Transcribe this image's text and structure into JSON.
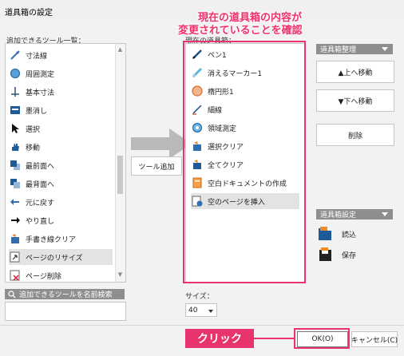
{
  "window": {
    "title": "道具箱の設定"
  },
  "annotation": {
    "line1": "現在の道具箱の内容が",
    "line2": "変更されていることを確認",
    "click": "クリック"
  },
  "available": {
    "label": "追加できるツール一覧：",
    "items": [
      {
        "label": "寸法線",
        "icon": "dimension-icon"
      },
      {
        "label": "周囲測定",
        "icon": "perimeter-icon"
      },
      {
        "label": "基本寸法",
        "icon": "basic-dimension-icon"
      },
      {
        "label": "墨消し",
        "icon": "redact-icon"
      },
      {
        "label": "選択",
        "icon": "cursor-icon"
      },
      {
        "label": "移動",
        "icon": "hand-icon"
      },
      {
        "label": "最前面へ",
        "icon": "bring-front-icon"
      },
      {
        "label": "最背面へ",
        "icon": "send-back-icon"
      },
      {
        "label": "元に戻す",
        "icon": "undo-icon"
      },
      {
        "label": "やり直し",
        "icon": "redo-icon"
      },
      {
        "label": "手書き線クリア",
        "icon": "clear-handwriting-icon"
      },
      {
        "label": "ページのリサイズ",
        "icon": "page-resize-icon"
      },
      {
        "label": "ページ削除",
        "icon": "page-delete-icon"
      }
    ]
  },
  "add_button": "ツール追加",
  "current": {
    "label": "現在の道具箱：",
    "items": [
      {
        "label": "ペン1",
        "icon": "pen-icon"
      },
      {
        "label": "消えるマーカー1",
        "icon": "marker-icon"
      },
      {
        "label": "楕円形1",
        "icon": "ellipse-icon"
      },
      {
        "label": "細線",
        "icon": "thin-line-icon"
      },
      {
        "label": "領域測定",
        "icon": "area-measure-icon"
      },
      {
        "label": "選択クリア",
        "icon": "selection-clear-icon"
      },
      {
        "label": "全てクリア",
        "icon": "clear-all-icon"
      },
      {
        "label": "空白ドキュメントの作成",
        "icon": "blank-document-icon"
      },
      {
        "label": "空のページを挿入",
        "icon": "insert-page-icon"
      }
    ]
  },
  "organize": {
    "header": "道具箱整理",
    "move_up": "▲上へ移動",
    "move_down": "▼下へ移動",
    "delete": "削除"
  },
  "settings": {
    "header": "道具箱設定",
    "load": "読込",
    "save": "保存"
  },
  "search": {
    "label": "追加できるツールを名前検索",
    "value": ""
  },
  "size": {
    "label": "サイズ：",
    "value": "40"
  },
  "footer": {
    "ok": "OK(O)",
    "cancel": "キャンセル(C)"
  },
  "colors": {
    "accent": "#e8336c",
    "header_gray": "#8e8e8e"
  }
}
